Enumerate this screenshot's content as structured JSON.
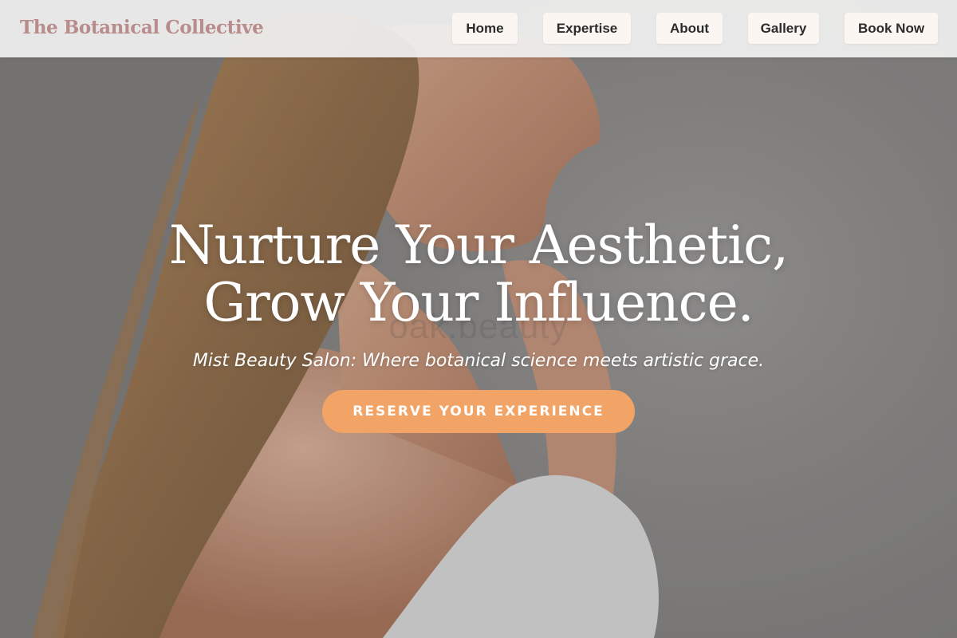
{
  "header": {
    "brand": "The Botanical Collective",
    "nav": {
      "home": "Home",
      "expertise": "Expertise",
      "about": "About",
      "gallery": "Gallery",
      "book": "Book Now"
    }
  },
  "hero": {
    "headline_line1": "Nurture Your Aesthetic,",
    "headline_line2": "Grow Your Influence.",
    "watermark": "oak.beauty",
    "tagline": "Mist Beauty Salon: Where botanical science meets artistic grace.",
    "cta": "RESERVE YOUR EXPERIENCE",
    "image_description_icon": "woman-profile-photo"
  },
  "colors": {
    "brand": "#b98c8c",
    "cta": "#f2a467",
    "nav_button_bg": "#fbf6f1",
    "header_bg": "#f0f0f0",
    "hero_text": "#ffffff"
  }
}
